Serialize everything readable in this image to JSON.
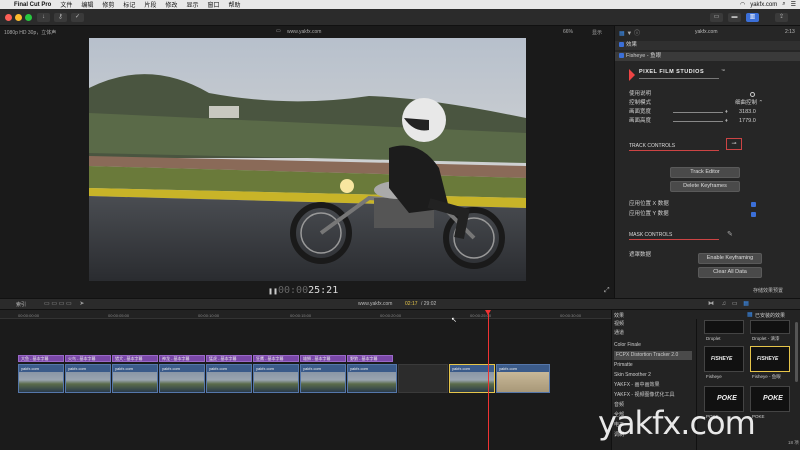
{
  "menubar": {
    "app": "Final Cut Pro",
    "items": [
      "文件",
      "编辑",
      "修剪",
      "标记",
      "片段",
      "修改",
      "显示",
      "窗口",
      "帮助"
    ],
    "right_user": "yakfx.com"
  },
  "viewer": {
    "format_label": "1080p HD 30p，立体声",
    "project_label": "www.yakfx.com",
    "zoom": "66%",
    "display_menu": "显示",
    "timecode_hidden": "00:00",
    "timecode": "25:21"
  },
  "inspector": {
    "header_title": "yakfx.com",
    "header_time": "2:13",
    "effects_label": "效果",
    "effect_name": "Fisheye - 鱼眼",
    "brand": "PIXEL FILM STUDIOS",
    "brand_tm": "™",
    "params": [
      {
        "label": "使用说明",
        "value": ""
      },
      {
        "label": "控制模式",
        "value": "细曲控制 ⌃"
      },
      {
        "label": "画面宽度",
        "value": "3183.0"
      },
      {
        "label": "画面高度",
        "value": "1779.0"
      }
    ],
    "track_controls": "TRACK CONTROLS",
    "track_editor": "Track Editor",
    "delete_keyframes": "Delete Keyframes",
    "apply_x": "应用位置 X 数据",
    "apply_y": "应用位置 Y 数据",
    "mask_controls": "MASK CONTROLS",
    "mask_data": "遮罩数据",
    "enable_keyframing": "Enable Keyframing",
    "clear_all_data": "Clear All Data",
    "save_preset": "存储效果预置"
  },
  "timeline_bar": {
    "index_label": "索引",
    "project": "www.yakfx.com",
    "position": "02:17",
    "duration": "/ 29:02"
  },
  "timeline": {
    "ruler": [
      "00:00:00:00",
      "00:00:05:00",
      "00:00:10:00",
      "00:00:15:00",
      "00:00:20:00",
      "00:00:25:00",
      "00:00:30:00"
    ],
    "title_clips": [
      "大鱼 - 基本字幕",
      "火鸟 - 基本字幕",
      "猎犬 - 基本字幕",
      "神龙 - 基本字幕",
      "猛虎 - 基本字幕",
      "狂鹰 - 基本字幕",
      "雄狮 - 基本字幕",
      "野狼 - 基本字幕"
    ],
    "video_clip_label": "yakfx.com",
    "last_clips": [
      "yakfx.com",
      "yakfx.com"
    ]
  },
  "effects": {
    "header": "效果",
    "installed": "已安装的效果",
    "categories": [
      "视频",
      "通道",
      "",
      "Color Finale",
      "FCPX Distortion Tracker 2.0",
      "Primatte",
      "Skin Smoother 2",
      "YAKFX - 画中画效果",
      "YAKFX - 视频图像优化工具",
      "音频",
      "全部",
      "电平",
      "调制"
    ],
    "thumbs": [
      {
        "label": "Droplet"
      },
      {
        "label": "Droplet - 滴漆"
      },
      {
        "label": "Fisheye"
      },
      {
        "label": "Fisheye - 鱼眼"
      },
      {
        "label": "POKE"
      },
      {
        "label": "POKE"
      }
    ],
    "count": "18 项"
  },
  "watermark": "yakfx.com"
}
